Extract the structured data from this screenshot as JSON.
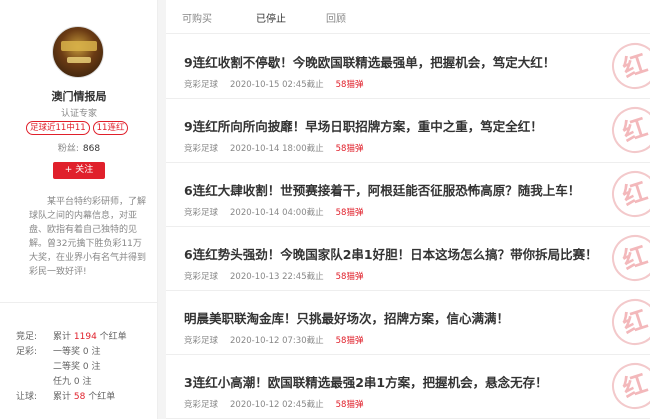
{
  "profile": {
    "name": "澳门情报局",
    "role": "认证专家",
    "tags": [
      "足球近11中11",
      "11连红"
    ],
    "fans_label": "粉丝:",
    "fans_count": "868",
    "follow_label": "+ 关注",
    "intro": "某平台特约彩研师，了解球队之间的内幕信息，对亚盘、欧指有着自己独特的见解。曾32元擒下胜负彩11万大奖，在业界小有名气并得到彩民一致好评!"
  },
  "stats": [
    {
      "cat": "竞足:",
      "label": "累计",
      "value": "1194",
      "unit": "个红单"
    },
    {
      "cat": "足彩:",
      "label": "一等奖",
      "value": "0",
      "unit": "注"
    },
    {
      "cat": "",
      "label": "二等奖",
      "value": "0",
      "unit": "注"
    },
    {
      "cat": "",
      "label": "任九",
      "value": "0",
      "unit": "注"
    },
    {
      "cat": "让球:",
      "label": "累计",
      "value": "58",
      "unit": "个红单"
    }
  ],
  "tabs": [
    "可购买",
    "已停止",
    "回顾"
  ],
  "active_tab": 1,
  "items": [
    {
      "title": "9连红收割不停歇！今晚欧国联精选最强单，把握机会，笃定大红！",
      "category": "竞彩足球",
      "time": "2020-10-15 02:45截止",
      "price": "58猫弹"
    },
    {
      "title": "9连红所向所向披靡！早场日职招牌方案，重中之重，笃定全红！",
      "category": "竞彩足球",
      "time": "2020-10-14 18:00截止",
      "price": "58猫弹"
    },
    {
      "title": "6连红大肆收割！世预赛接着干，阿根廷能否征服恐怖高原？随我上车！",
      "category": "竞彩足球",
      "time": "2020-10-14 04:00截止",
      "price": "58猫弹"
    },
    {
      "title": "6连红势头强劲！今晚国家队2串1好胆！日本这场怎么搞？带你拆局比赛！",
      "category": "竞彩足球",
      "time": "2020-10-13 22:45截止",
      "price": "58猫弹"
    },
    {
      "title": "明晨美职联淘金库！只挑最好场次，招牌方案，信心满满！",
      "category": "竞彩足球",
      "time": "2020-10-12 07:30截止",
      "price": "58猫弹"
    },
    {
      "title": "3连红小高潮！欧国联精选最强2串1方案，把握机会，悬念无存！",
      "category": "竞彩足球",
      "time": "2020-10-12 02:45截止",
      "price": "58猫弹"
    }
  ],
  "stamp_text": "红",
  "colors": {
    "accent": "#e0202b",
    "stamp": "#f3b8bb"
  }
}
